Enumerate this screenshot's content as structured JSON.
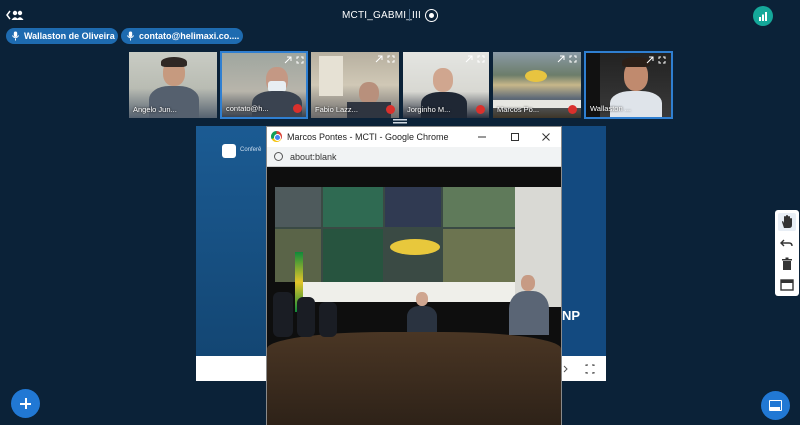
{
  "meeting": {
    "title": "MCTI_GABMI_III"
  },
  "talkers": [
    {
      "name": "Wallaston de Oliveira"
    },
    {
      "name": "contato@helimaxi.co...."
    }
  ],
  "participants": [
    {
      "name": "Angelo Jun...",
      "muted": false,
      "active": false
    },
    {
      "name": "contato@h...",
      "muted": true,
      "active": true
    },
    {
      "name": "Fabio Lazz...",
      "muted": true,
      "active": false
    },
    {
      "name": "Jorginho M...",
      "muted": true,
      "active": false
    },
    {
      "name": "Marcos Po...",
      "muted": true,
      "active": false
    },
    {
      "name": "Wallaston ...",
      "muted": false,
      "active": true
    }
  ],
  "presentation": {
    "logo_text": "Conferê",
    "side_text": "NP"
  },
  "browser": {
    "title": "Marcos Pontes - MCTI - Google Chrome",
    "url": "about:blank"
  },
  "colors": {
    "background": "#0b2238",
    "accent": "#2178d4",
    "talker": "#1e6bb0",
    "muted": "#d9302c"
  }
}
